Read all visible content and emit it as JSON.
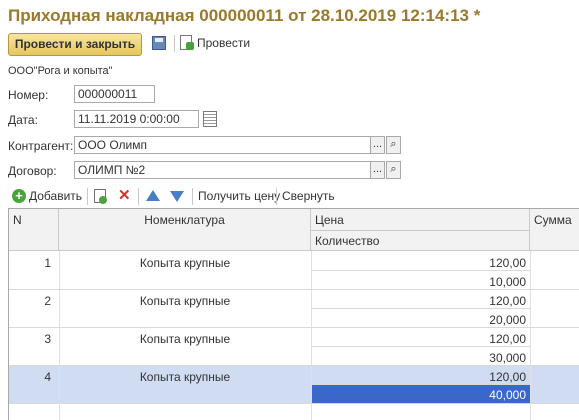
{
  "window": {
    "title": "Приходная накладная 000000011 от 28.10.2019 12:14:13 *"
  },
  "toolbar": {
    "post_and_close": "Провести и закрыть",
    "save_icon": "floppy-disk-icon",
    "post": "Провести"
  },
  "form": {
    "organization": "ООО\"Рога и копыта\"",
    "number_label": "Номер:",
    "number_value": "000000011",
    "date_label": "Дата:",
    "date_value": "11.11.2019  0:00:00",
    "counterparty_label": "Контрагент:",
    "counterparty_value": "ООО Олимп",
    "contract_label": "Договор:",
    "contract_value": "ОЛИМП №2",
    "select_button": "...",
    "search_icon": "magnifier-icon"
  },
  "table_toolbar": {
    "add": "Добавить",
    "get_price": "Получить цену",
    "collapse": "Свернуть"
  },
  "table": {
    "columns": {
      "n": "N",
      "item": "Номенклатура",
      "price": "Цена",
      "qty": "Количество",
      "sum": "Сумма"
    },
    "rows": [
      {
        "n": "1",
        "item": "Копыта крупные",
        "price": "120,00",
        "qty": "10,000"
      },
      {
        "n": "2",
        "item": "Копыта крупные",
        "price": "120,00",
        "qty": "20,000"
      },
      {
        "n": "3",
        "item": "Копыта крупные",
        "price": "120,00",
        "qty": "30,000"
      },
      {
        "n": "4",
        "item": "Копыта крупные",
        "price": "120,00",
        "qty": "40,000"
      }
    ],
    "selected_row": 4
  },
  "colors": {
    "title": "#9a7a2a",
    "primary_button": "#e6c65c",
    "selected_row": "#cfdcf2",
    "active_cell": "#3a67c8"
  }
}
